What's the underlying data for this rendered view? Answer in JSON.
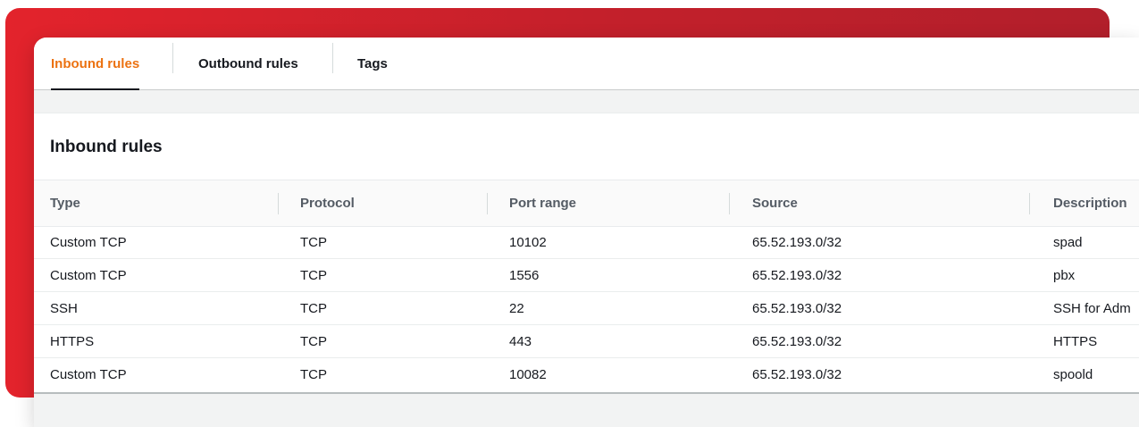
{
  "tabs": [
    {
      "label": "Inbound rules",
      "active": true
    },
    {
      "label": "Outbound rules",
      "active": false
    },
    {
      "label": "Tags",
      "active": false
    }
  ],
  "section_title": "Inbound rules",
  "columns": [
    "Type",
    "Protocol",
    "Port range",
    "Source",
    "Description"
  ],
  "rows": [
    [
      "Custom TCP",
      "TCP",
      "10102",
      "65.52.193.0/32",
      "spad"
    ],
    [
      "Custom TCP",
      "TCP",
      "1556",
      "65.52.193.0/32",
      "pbx"
    ],
    [
      "SSH",
      "TCP",
      "22",
      "65.52.193.0/32",
      "SSH for Adm"
    ],
    [
      "HTTPS",
      "TCP",
      "443",
      "65.52.193.0/32",
      "HTTPS"
    ],
    [
      "Custom TCP",
      "TCP",
      "10082",
      "65.52.193.0/32",
      "spoold"
    ]
  ],
  "colors": {
    "accent": "#ec7211",
    "brand_red": "#d8222b"
  }
}
